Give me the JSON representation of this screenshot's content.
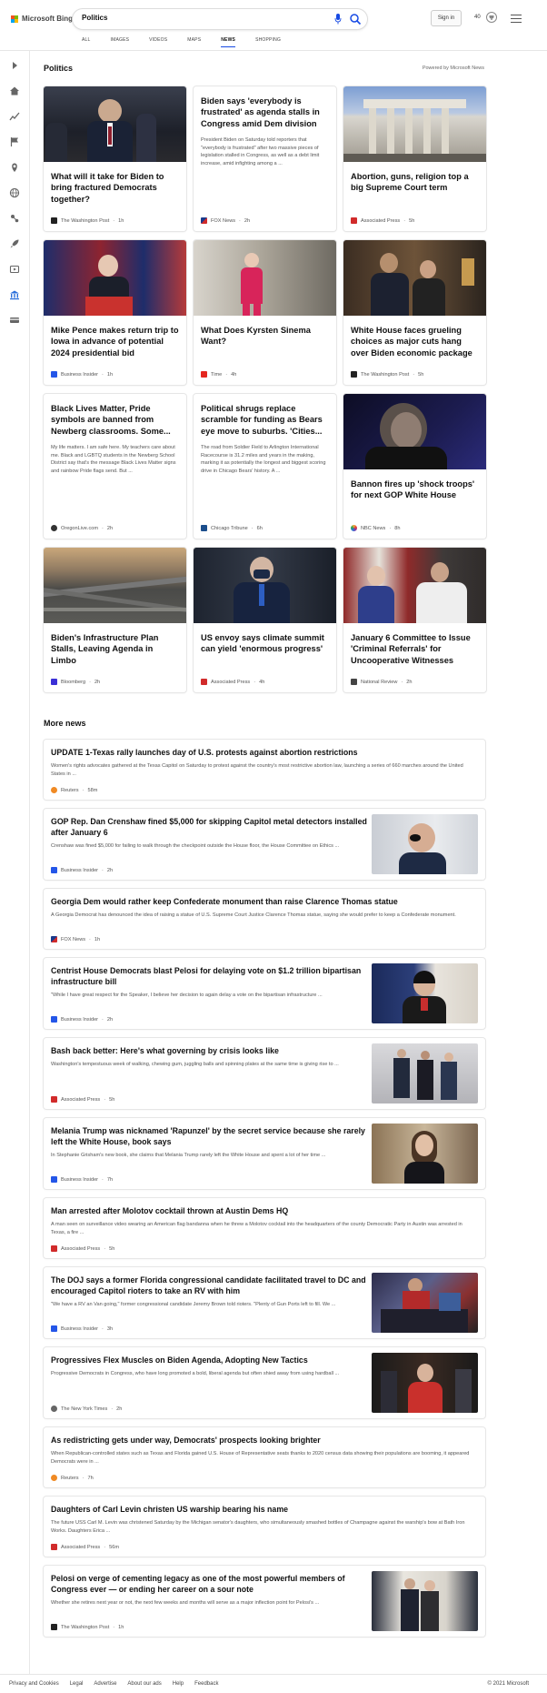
{
  "header": {
    "logo_text": "Microsoft Bing",
    "query": "Politics",
    "signin_label": "Sign in",
    "points": "40",
    "tabs": [
      {
        "label": "ALL"
      },
      {
        "label": "IMAGES"
      },
      {
        "label": "VIDEOS"
      },
      {
        "label": "MAPS"
      },
      {
        "label": "NEWS"
      },
      {
        "label": "SHOPPING"
      }
    ],
    "active_tab": "NEWS"
  },
  "section": {
    "title": "Politics",
    "powered_by": "Powered by Microsoft News"
  },
  "cards": [
    {
      "title": "What will it take for Biden to bring fractured Democrats together?",
      "source": "The Washington Post",
      "time": "1h",
      "favicon": "#222222",
      "image": true
    },
    {
      "title": "Biden says 'everybody is frustrated' as agenda stalls in Congress amid Dem division",
      "snippet": "President Biden on Saturday told reporters that \"everybody is frustrated\" after two massive pieces of legislation stalled in Congress, as well as a debt limit increase, amid infighting among a ...",
      "source": "FOX News",
      "time": "2h",
      "favicon": "#1a3a8c",
      "image": false
    },
    {
      "title": "Abortion, guns, religion top a big Supreme Court term",
      "source": "Associated Press",
      "time": "5h",
      "favicon": "#d12b2b",
      "image": true
    },
    {
      "title": "Mike Pence makes return trip to Iowa in advance of potential 2024 presidential bid",
      "source": "Business Insider",
      "time": "1h",
      "favicon": "#2456e8",
      "image": true
    },
    {
      "title": "What Does Kyrsten Sinema Want?",
      "source": "Time",
      "time": "4h",
      "favicon": "#e4261f",
      "image": true
    },
    {
      "title": "White House faces grueling choices as major cuts hang over Biden economic package",
      "source": "The Washington Post",
      "time": "5h",
      "favicon": "#222222",
      "image": true
    },
    {
      "title": "Black Lives Matter, Pride symbols are banned from Newberg classrooms. Some...",
      "snippet": "My life matters. I am safe here. My teachers care about me. Black and LGBTQ students in the Newberg School District say that's the message Black Lives Matter signs and rainbow Pride flags send. But ...",
      "source": "OregonLive.com",
      "time": "2h",
      "favicon": "#333333",
      "image": false
    },
    {
      "title": "Political shrugs replace scramble for funding as Bears eye move to suburbs. 'Cities...",
      "snippet": "The road from Soldier Field to Arlington International Racecourse is 31.2 miles and years in the making, marking it as potentially the longest and biggest scoring drive in Chicago Bears' history. A ...",
      "source": "Chicago Tribune",
      "time": "6h",
      "favicon": "#1b4e8c",
      "image": false
    },
    {
      "title": "Bannon fires up 'shock troops' for next GOP White House",
      "source": "NBC News",
      "time": "8h",
      "favicon": "#555555",
      "image": true
    },
    {
      "title": "Biden's Infrastructure Plan Stalls, Leaving Agenda in Limbo",
      "source": "Bloomberg",
      "time": "2h",
      "favicon": "#3a2fd6",
      "image": true
    },
    {
      "title": "US envoy says climate summit can yield 'enormous progress'",
      "source": "Associated Press",
      "time": "4h",
      "favicon": "#d12b2b",
      "image": true
    },
    {
      "title": "January 6 Committee to Issue 'Criminal Referrals' for Uncooperative Witnesses",
      "source": "National Review",
      "time": "2h",
      "favicon": "#444444",
      "image": true
    }
  ],
  "more_news": {
    "title": "More news",
    "items": [
      {
        "title": "UPDATE 1-Texas rally launches day of U.S. protests against abortion restrictions",
        "snippet": "Women's rights advocates gathered at the Texas Capitol on Saturday to protest against the country's most restrictive abortion law, launching a series of 660 marches around the United States in ...",
        "source": "Reuters",
        "time": "58m",
        "favicon": "#f08a24",
        "image": false
      },
      {
        "title": "GOP Rep. Dan Crenshaw fined $5,000 for skipping Capitol metal detectors installed after January 6",
        "snippet": "Crenshaw was fined $5,000 for failing to walk through the checkpoint outside the House floor, the House Committee on Ethics ...",
        "source": "Business Insider",
        "time": "2h",
        "favicon": "#2456e8",
        "image": true
      },
      {
        "title": "Georgia Dem would rather keep Confederate monument than raise Clarence Thomas statue",
        "snippet": "A Georgia Democrat has denounced the idea of raising a statue of U.S. Supreme Court Justice Clarence Thomas statue, saying she would prefer to keep a Confederate monument.",
        "source": "FOX News",
        "time": "1h",
        "favicon": "#1a3a8c",
        "image": false
      },
      {
        "title": "Centrist House Democrats blast Pelosi for delaying vote on $1.2 trillion bipartisan infrastructure bill",
        "snippet": "\"While I have great respect for the Speaker, I believe her decision to again delay a vote on the bipartisan infrastructure ...",
        "source": "Business Insider",
        "time": "2h",
        "favicon": "#2456e8",
        "image": true
      },
      {
        "title": "Bash back better: Here's what governing by crisis looks like",
        "snippet": "Washington's tempestuous week of walking, chewing gum, juggling balls and spinning plates at the same time is giving rise to ...",
        "source": "Associated Press",
        "time": "5h",
        "favicon": "#d12b2b",
        "image": true
      },
      {
        "title": "Melania Trump was nicknamed 'Rapunzel' by the secret service because she rarely left the White House, book says",
        "snippet": "In Stephanie Grisham's new book, she claims that Melania Trump rarely left the White House and spent a lot of her time ...",
        "source": "Business Insider",
        "time": "7h",
        "favicon": "#2456e8",
        "image": true
      },
      {
        "title": "Man arrested after Molotov cocktail thrown at Austin Dems HQ",
        "snippet": "A man seen on surveillance video wearing an American flag bandanna when he threw a Molotov cocktail into the headquarters of the county Democratic Party in Austin was arrested in Texas, a fire ...",
        "source": "Associated Press",
        "time": "5h",
        "favicon": "#d12b2b",
        "image": false
      },
      {
        "title": "The DOJ says a former Florida congressional candidate facilitated travel to DC and encouraged Capitol rioters to take an RV with him",
        "snippet": "\"We have a RV an Van going,\" former congressional candidate Jeremy Brown told rioters. \"Plenty of Gun Ports left to fill. We ...",
        "source": "Business Insider",
        "time": "3h",
        "favicon": "#2456e8",
        "image": true
      },
      {
        "title": "Progressives Flex Muscles on Biden Agenda, Adopting New Tactics",
        "snippet": "Progressive Democrats in Congress, who have long promoted a bold, liberal agenda but often shied away from using hardball ...",
        "source": "The New York Times",
        "time": "2h",
        "favicon": "#666666",
        "image": true
      },
      {
        "title": "As redistricting gets under way, Democrats' prospects looking brighter",
        "snippet": "When Republican-controlled states such as Texas and Florida gained U.S. House of Representative seats thanks to 2020 census data showing their populations are booming, it appeared Democrats were in ...",
        "source": "Reuters",
        "time": "7h",
        "favicon": "#f08a24",
        "image": false
      },
      {
        "title": "Daughters of Carl Levin christen US warship bearing his name",
        "snippet": "The future USS Carl M. Levin was christened Saturday by the Michigan senator's daughters, who simultaneously smashed bottles of Champagne against the warship's bow at Bath Iron Works. Daughters Erica ...",
        "source": "Associated Press",
        "time": "56m",
        "favicon": "#d12b2b",
        "image": false
      },
      {
        "title": "Pelosi on verge of cementing legacy as one of the most powerful members of Congress ever — or ending her career on a sour note",
        "snippet": "Whether she retires next year or not, the next few weeks and months will serve as a major inflection point for Pelosi's ...",
        "source": "The Washington Post",
        "time": "1h",
        "favicon": "#222222",
        "image": true
      }
    ]
  },
  "footer": {
    "links": [
      "Privacy and Cookies",
      "Legal",
      "Advertise",
      "About our ads",
      "Help",
      "Feedback"
    ],
    "copyright": "© 2021 Microsoft"
  }
}
